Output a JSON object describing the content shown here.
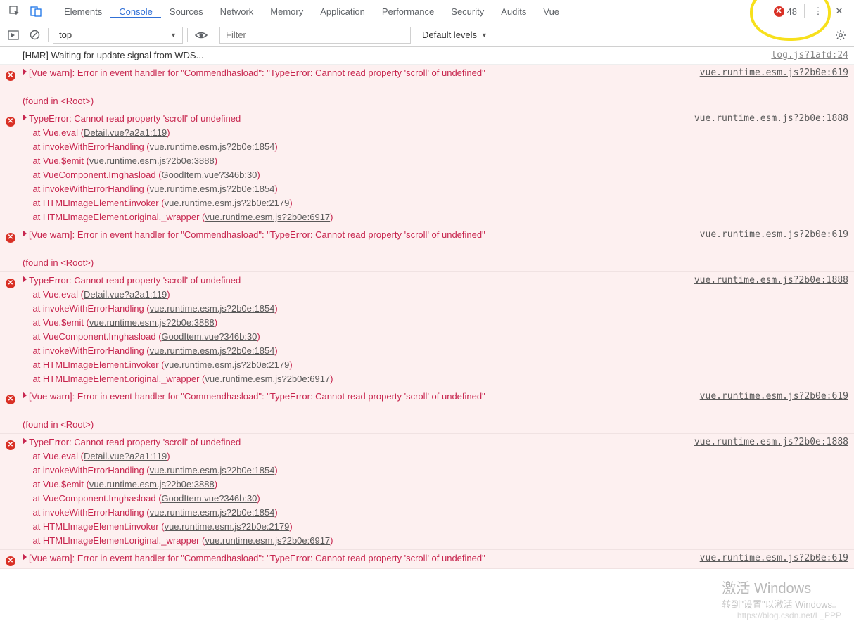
{
  "tabs": {
    "items": [
      "Elements",
      "Console",
      "Sources",
      "Network",
      "Memory",
      "Application",
      "Performance",
      "Security",
      "Audits",
      "Vue"
    ],
    "active": "Console",
    "error_count": "48"
  },
  "toolbar": {
    "context": "top",
    "filter_placeholder": "Filter",
    "levels": "Default levels"
  },
  "log_plain": {
    "msg": "[HMR] Waiting for update signal from WDS...",
    "src": "log.js?1afd:24"
  },
  "warn_msg": "[Vue warn]: Error in event handler for \"Commendhasload\": \"TypeError: Cannot read property 'scroll' of undefined\"\n\n(found in <Root>)",
  "warn_src": "vue.runtime.esm.js?2b0e:619",
  "err_head": "TypeError: Cannot read property 'scroll' of undefined",
  "err_src": "vue.runtime.esm.js?2b0e:1888",
  "stack": [
    {
      "pre": "    at Vue.eval (",
      "lnk": "Detail.vue?a2a1:119",
      "post": ")"
    },
    {
      "pre": "    at invokeWithErrorHandling (",
      "lnk": "vue.runtime.esm.js?2b0e:1854",
      "post": ")"
    },
    {
      "pre": "    at Vue.$emit (",
      "lnk": "vue.runtime.esm.js?2b0e:3888",
      "post": ")"
    },
    {
      "pre": "    at VueComponent.Imghasload (",
      "lnk": "GoodItem.vue?346b:30",
      "post": ")"
    },
    {
      "pre": "    at invokeWithErrorHandling (",
      "lnk": "vue.runtime.esm.js?2b0e:1854",
      "post": ")"
    },
    {
      "pre": "    at HTMLImageElement.invoker (",
      "lnk": "vue.runtime.esm.js?2b0e:2179",
      "post": ")"
    },
    {
      "pre": "    at HTMLImageElement.original._wrapper (",
      "lnk": "vue.runtime.esm.js?2b0e:6917",
      "post": ")"
    }
  ],
  "warn_short": "[Vue warn]: Error in event handler for \"Commendhasload\": \"TypeError: Cannot read property 'scroll' of undefined\"",
  "watermark": {
    "l1": "激活 Windows",
    "l2": "转到\"设置\"以激活 Windows。",
    "l3": "https://blog.csdn.net/L_PPP"
  }
}
